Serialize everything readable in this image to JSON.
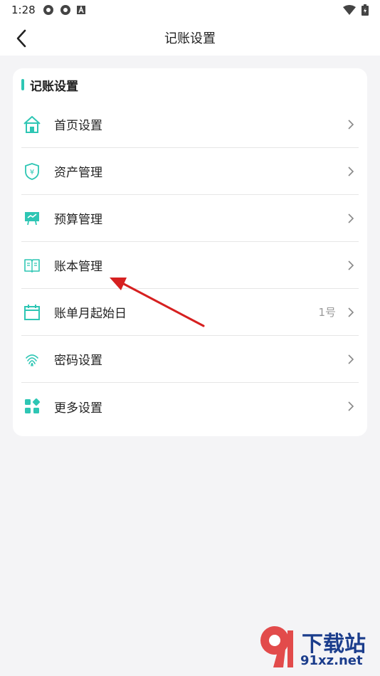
{
  "status_bar": {
    "time": "1:28"
  },
  "header": {
    "title": "记账设置"
  },
  "card": {
    "title": "记账设置",
    "items": [
      {
        "label": "首页设置",
        "value": "",
        "icon": "home-icon"
      },
      {
        "label": "资产管理",
        "value": "",
        "icon": "shield-yen-icon"
      },
      {
        "label": "预算管理",
        "value": "",
        "icon": "budget-icon"
      },
      {
        "label": "账本管理",
        "value": "",
        "icon": "book-icon"
      },
      {
        "label": "账单月起始日",
        "value": "1号",
        "icon": "calendar-icon"
      },
      {
        "label": "密码设置",
        "value": "",
        "icon": "fingerprint-icon"
      },
      {
        "label": "更多设置",
        "value": "",
        "icon": "apps-icon"
      }
    ]
  },
  "colors": {
    "accent": "#2ec6b4",
    "annotation_arrow": "#d62020"
  },
  "watermark": {
    "line1": "下载站",
    "line2": "91xz.net"
  }
}
